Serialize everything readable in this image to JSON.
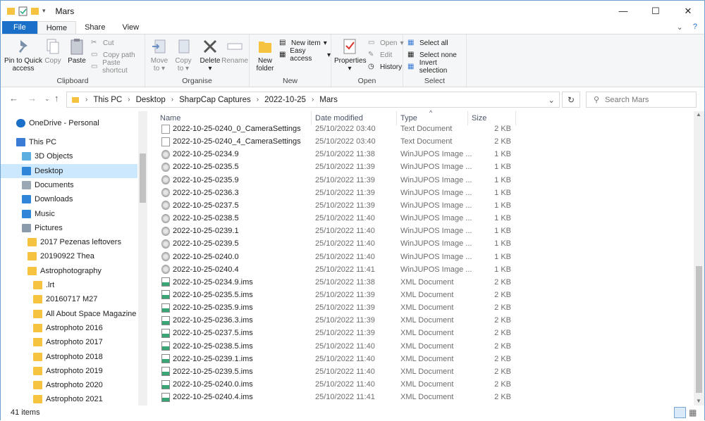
{
  "window": {
    "title": "Mars",
    "minimize": "—",
    "maximize": "☐",
    "close": "✕"
  },
  "tabs": {
    "file": "File",
    "home": "Home",
    "share": "Share",
    "view": "View"
  },
  "ribbon": {
    "pin": "Pin to Quick access",
    "copy": "Copy",
    "paste": "Paste",
    "cut": "Cut",
    "copy_path": "Copy path",
    "paste_shortcut": "Paste shortcut",
    "clipboard": "Clipboard",
    "move_to": "Move to",
    "copy_to": "Copy to",
    "delete": "Delete",
    "rename": "Rename",
    "organise": "Organise",
    "new_folder": "New folder",
    "new_item": "New item",
    "easy_access": "Easy access",
    "new": "New",
    "properties": "Properties",
    "open": "Open",
    "edit": "Edit",
    "history": "History",
    "open_group": "Open",
    "select_all": "Select all",
    "select_none": "Select none",
    "invert_selection": "Invert selection",
    "select": "Select"
  },
  "address": {
    "crumbs": [
      "This PC",
      "Desktop",
      "SharpCap Captures",
      "2022-10-25",
      "Mars"
    ],
    "search_placeholder": "Search Mars"
  },
  "nav": [
    {
      "label": "OneDrive - Personal",
      "kind": "cloud"
    },
    {
      "label": "This PC",
      "kind": "pc"
    },
    {
      "label": "3D Objects",
      "kind": "obj3d"
    },
    {
      "label": "Desktop",
      "kind": "desktop",
      "selected": true
    },
    {
      "label": "Documents",
      "kind": "docs"
    },
    {
      "label": "Downloads",
      "kind": "down"
    },
    {
      "label": "Music",
      "kind": "music"
    },
    {
      "label": "Pictures",
      "kind": "pics"
    },
    {
      "label": "2017 Pezenas leftovers",
      "kind": "folder"
    },
    {
      "label": "20190922 Thea",
      "kind": "folder"
    },
    {
      "label": "Astrophotography",
      "kind": "folder"
    },
    {
      "label": ".lrt",
      "kind": "folder"
    },
    {
      "label": "20160717 M27",
      "kind": "folder"
    },
    {
      "label": "All About Space Magazine",
      "kind": "folder"
    },
    {
      "label": "Astrophoto 2016",
      "kind": "folder"
    },
    {
      "label": "Astrophoto 2017",
      "kind": "folder"
    },
    {
      "label": "Astrophoto 2018",
      "kind": "folder"
    },
    {
      "label": "Astrophoto 2019",
      "kind": "folder"
    },
    {
      "label": "Astrophoto 2020",
      "kind": "folder"
    },
    {
      "label": "Astrophoto 2021",
      "kind": "folder"
    }
  ],
  "columns": {
    "name": "Name",
    "date": "Date modified",
    "type": "Type",
    "size": "Size"
  },
  "files": [
    {
      "name": "2022-10-25-0240_0_CameraSettings",
      "date": "25/10/2022 03:40",
      "type": "Text Document",
      "size": "2 KB",
      "icon": "txt"
    },
    {
      "name": "2022-10-25-0240_4_CameraSettings",
      "date": "25/10/2022 03:40",
      "type": "Text Document",
      "size": "2 KB",
      "icon": "txt"
    },
    {
      "name": "2022-10-25-0234.9",
      "date": "25/10/2022 11:38",
      "type": "WinJUPOS Image ...",
      "size": "1 KB",
      "icon": "jup"
    },
    {
      "name": "2022-10-25-0235.5",
      "date": "25/10/2022 11:39",
      "type": "WinJUPOS Image ...",
      "size": "1 KB",
      "icon": "jup"
    },
    {
      "name": "2022-10-25-0235.9",
      "date": "25/10/2022 11:39",
      "type": "WinJUPOS Image ...",
      "size": "1 KB",
      "icon": "jup"
    },
    {
      "name": "2022-10-25-0236.3",
      "date": "25/10/2022 11:39",
      "type": "WinJUPOS Image ...",
      "size": "1 KB",
      "icon": "jup"
    },
    {
      "name": "2022-10-25-0237.5",
      "date": "25/10/2022 11:39",
      "type": "WinJUPOS Image ...",
      "size": "1 KB",
      "icon": "jup"
    },
    {
      "name": "2022-10-25-0238.5",
      "date": "25/10/2022 11:40",
      "type": "WinJUPOS Image ...",
      "size": "1 KB",
      "icon": "jup"
    },
    {
      "name": "2022-10-25-0239.1",
      "date": "25/10/2022 11:40",
      "type": "WinJUPOS Image ...",
      "size": "1 KB",
      "icon": "jup"
    },
    {
      "name": "2022-10-25-0239.5",
      "date": "25/10/2022 11:40",
      "type": "WinJUPOS Image ...",
      "size": "1 KB",
      "icon": "jup"
    },
    {
      "name": "2022-10-25-0240.0",
      "date": "25/10/2022 11:40",
      "type": "WinJUPOS Image ...",
      "size": "1 KB",
      "icon": "jup"
    },
    {
      "name": "2022-10-25-0240.4",
      "date": "25/10/2022 11:41",
      "type": "WinJUPOS Image ...",
      "size": "1 KB",
      "icon": "jup"
    },
    {
      "name": "2022-10-25-0234.9.ims",
      "date": "25/10/2022 11:38",
      "type": "XML Document",
      "size": "2 KB",
      "icon": "xml"
    },
    {
      "name": "2022-10-25-0235.5.ims",
      "date": "25/10/2022 11:39",
      "type": "XML Document",
      "size": "2 KB",
      "icon": "xml"
    },
    {
      "name": "2022-10-25-0235.9.ims",
      "date": "25/10/2022 11:39",
      "type": "XML Document",
      "size": "2 KB",
      "icon": "xml"
    },
    {
      "name": "2022-10-25-0236.3.ims",
      "date": "25/10/2022 11:39",
      "type": "XML Document",
      "size": "2 KB",
      "icon": "xml"
    },
    {
      "name": "2022-10-25-0237.5.ims",
      "date": "25/10/2022 11:39",
      "type": "XML Document",
      "size": "2 KB",
      "icon": "xml"
    },
    {
      "name": "2022-10-25-0238.5.ims",
      "date": "25/10/2022 11:40",
      "type": "XML Document",
      "size": "2 KB",
      "icon": "xml"
    },
    {
      "name": "2022-10-25-0239.1.ims",
      "date": "25/10/2022 11:40",
      "type": "XML Document",
      "size": "2 KB",
      "icon": "xml"
    },
    {
      "name": "2022-10-25-0239.5.ims",
      "date": "25/10/2022 11:40",
      "type": "XML Document",
      "size": "2 KB",
      "icon": "xml"
    },
    {
      "name": "2022-10-25-0240.0.ims",
      "date": "25/10/2022 11:40",
      "type": "XML Document",
      "size": "2 KB",
      "icon": "xml"
    },
    {
      "name": "2022-10-25-0240.4.ims",
      "date": "25/10/2022 11:41",
      "type": "XML Document",
      "size": "2 KB",
      "icon": "xml"
    }
  ],
  "status": {
    "count": "41 items"
  }
}
